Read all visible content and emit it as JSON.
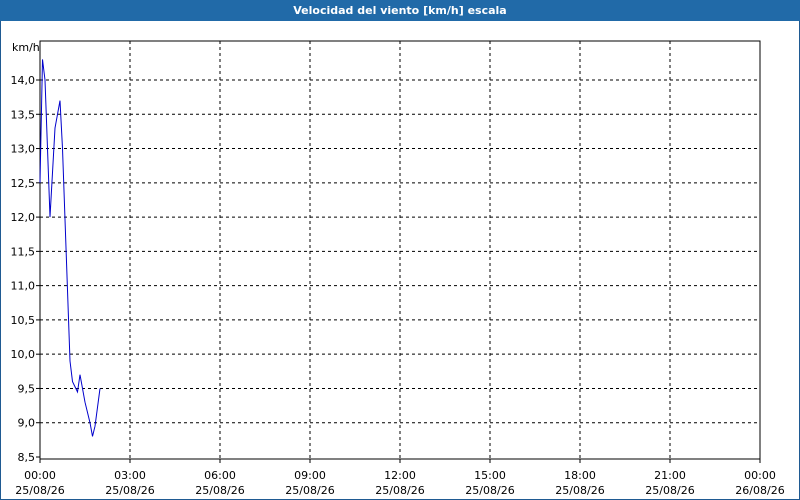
{
  "window": {
    "title": "Velocidad del viento [km/h] escala"
  },
  "colors": {
    "titlebar": "#216aa8",
    "series": "#0000cc",
    "grid": "#000000"
  },
  "chart_data": {
    "type": "line",
    "title": "Velocidad del viento [km/h] escala",
    "ylabel": "km/h",
    "xlabel": "",
    "ylim": [
      8.5,
      14.5
    ],
    "xlim": [
      "2026-08-25 00:00",
      "2026-08-26 00:00"
    ],
    "y_ticks": [
      "8,5",
      "9,0",
      "9,5",
      "10,0",
      "10,5",
      "11,0",
      "11,5",
      "12,0",
      "12,5",
      "13,0",
      "13,5",
      "14,0"
    ],
    "x_ticks": [
      {
        "time": "00:00",
        "date": "25/08/26"
      },
      {
        "time": "03:00",
        "date": "25/08/26"
      },
      {
        "time": "06:00",
        "date": "25/08/26"
      },
      {
        "time": "09:00",
        "date": "25/08/26"
      },
      {
        "time": "12:00",
        "date": "25/08/26"
      },
      {
        "time": "15:00",
        "date": "25/08/26"
      },
      {
        "time": "18:00",
        "date": "25/08/26"
      },
      {
        "time": "21:00",
        "date": "25/08/26"
      },
      {
        "time": "00:00",
        "date": "26/08/26"
      }
    ],
    "grid": true,
    "series": [
      {
        "x": [
          "2026-08-25 00:00",
          "2026-08-25 00:05",
          "2026-08-25 00:10",
          "2026-08-25 00:20",
          "2026-08-25 00:30",
          "2026-08-25 00:40",
          "2026-08-25 00:45",
          "2026-08-25 01:00",
          "2026-08-25 01:05",
          "2026-08-25 01:15",
          "2026-08-25 01:20",
          "2026-08-25 01:30",
          "2026-08-25 01:40",
          "2026-08-25 01:45",
          "2026-08-25 01:50",
          "2026-08-25 02:00"
        ],
        "y": [
          12.5,
          14.3,
          14.0,
          12.0,
          13.3,
          13.7,
          13.0,
          9.9,
          9.6,
          9.45,
          9.7,
          9.3,
          9.0,
          8.8,
          8.95,
          9.5
        ]
      }
    ]
  }
}
